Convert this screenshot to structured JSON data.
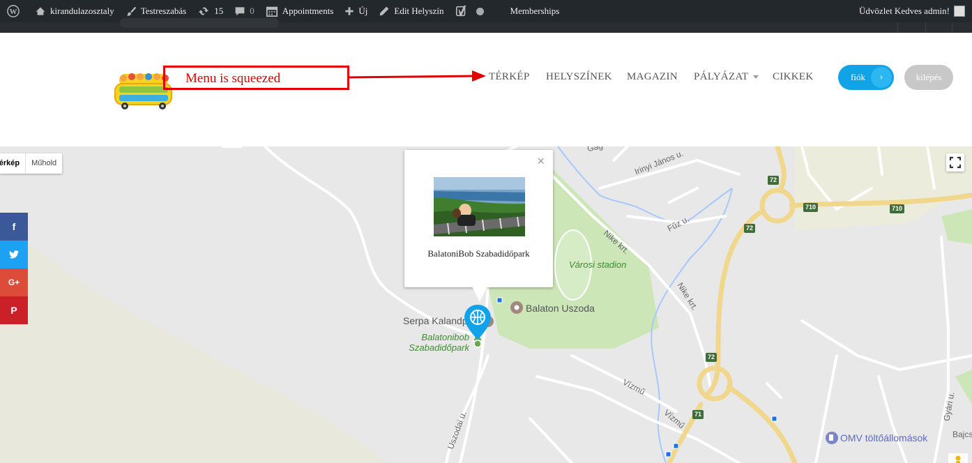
{
  "adminbar": {
    "site_name": "kirandulazosztaly",
    "customize": "Testreszabás",
    "updates_count": "15",
    "comments_count": "0",
    "appointments": "Appointments",
    "new": "Új",
    "edit_location": "Edit Helyszín",
    "memberships": "Memberships",
    "greeting": "Üdvözlet Kedves admin!"
  },
  "annotation": {
    "text": "Menu is squeezed"
  },
  "nav": {
    "items": [
      "TÉRKÉP",
      "HELYSZÍNEK",
      "MAGAZIN",
      "PÁLYÁZAT",
      "CIKKEK"
    ]
  },
  "buttons": {
    "account": "fiók",
    "account_arrow": "›",
    "logout": "kilépés"
  },
  "map": {
    "type_map": "Térkép",
    "type_satellite": "Műhold",
    "infowindow_title": "BalatoniBob Szabadidőpark",
    "infowindow_close": "×",
    "labels": {
      "street_gag": "Gág",
      "street_irinyi": "Irinyi János u.",
      "street_fuz": "Fűz u.",
      "street_nike1": "Nike krt.",
      "street_nike2": "Nike krt.",
      "stadium": "Városi stadion",
      "pool": "Balaton Uszoda",
      "serpa": "Serpa Kalandp",
      "bob_line1": "Balatonibob",
      "bob_line2": "Szabadidőpark",
      "street_vizmu1": "Vízmű",
      "street_vizmu2": "Vízmű",
      "street_uszodai": "Uszodai u.",
      "omv": "OMV töltőállomások",
      "street_gyari": "Gyári u.",
      "street_bajcsy": "Bajcs"
    },
    "shields": [
      "72",
      "710",
      "710",
      "72",
      "72",
      "71"
    ]
  },
  "social": {
    "facebook": "f",
    "twitter": "t",
    "google": "G+",
    "pinterest": "P"
  },
  "colors": {
    "accent": "#10a3e6",
    "annotation": "#e00000",
    "facebook": "#3b5998",
    "twitter": "#1da1f2",
    "google": "#dd4b39",
    "pinterest": "#cb2027"
  }
}
